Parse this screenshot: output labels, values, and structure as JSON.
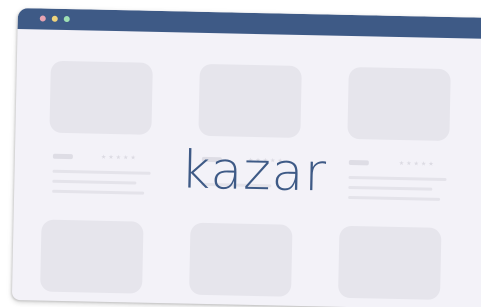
{
  "window": {
    "title_dots": [
      "close",
      "minimize",
      "maximize"
    ],
    "colors": {
      "titlebar": "#3e5a86",
      "background": "#f3f2f8",
      "placeholder": "#e6e5ec",
      "dot_close": "#e7a3b2",
      "dot_minimize": "#f0d47c",
      "dot_maximize": "#9fe0b4"
    }
  },
  "brand": {
    "logo_text": "kazar",
    "color": "#3e5a86"
  },
  "products": {
    "rating_glyphs": "★★★★★"
  }
}
